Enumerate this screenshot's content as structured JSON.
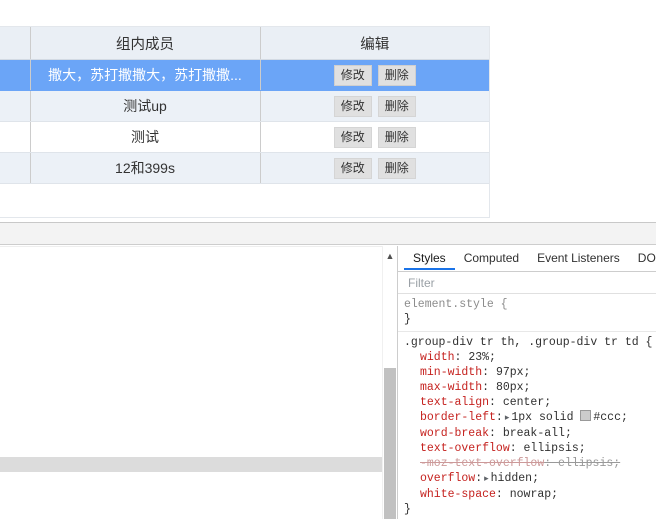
{
  "page": {
    "table": {
      "columns": [
        {
          "key": "index",
          "label": ""
        },
        {
          "key": "members",
          "label": "组内成员"
        },
        {
          "key": "edit",
          "label": "编辑"
        }
      ],
      "rows": [
        {
          "index": "",
          "members": "撒大，苏打撒撒大，苏打撒撒...",
          "edit_buttons": [
            "修改",
            "删除"
          ],
          "selected": true
        },
        {
          "index": "",
          "members": "测试up",
          "edit_buttons": [
            "修改",
            "删除"
          ],
          "selected": false
        },
        {
          "index": "",
          "members": "测试",
          "edit_buttons": [
            "修改",
            "删除"
          ],
          "selected": false
        },
        {
          "index": "",
          "members": "12和399s",
          "edit_buttons": [
            "修改",
            "删除"
          ],
          "selected": false
        }
      ]
    },
    "colors": {
      "header_bg": "#eaeff5",
      "row_alt_bg": "#ecf1f7",
      "row_bg": "#ffffff",
      "selected_bg": "#6ba5f7",
      "cell_border": "#ccc"
    }
  },
  "devtools": {
    "scrollbar": {
      "up_arrow_icon": "▲"
    },
    "styles_panel": {
      "tabs": [
        {
          "label": "Styles",
          "active": true
        },
        {
          "label": "Computed",
          "active": false
        },
        {
          "label": "Event Listeners",
          "active": false
        },
        {
          "label": "DOM",
          "active": false
        }
      ],
      "filter": {
        "value": "",
        "placeholder": "Filter"
      },
      "rules": [
        {
          "selector": "element.style {",
          "close": "}",
          "declarations": []
        },
        {
          "selector_parts": [
            ".group-div tr th, ",
            ".group-div tr td {"
          ],
          "selector": ".group-div tr th, .group-div tr td {",
          "close": "}",
          "declarations": [
            {
              "name": "width",
              "value": "23%;",
              "disclosure": false,
              "swatch": false,
              "disabled": false
            },
            {
              "name": "min-width",
              "value": "97px;",
              "disclosure": false,
              "swatch": false,
              "disabled": false
            },
            {
              "name": "max-width",
              "value": "80px;",
              "disclosure": false,
              "swatch": false,
              "disabled": false
            },
            {
              "name": "text-align",
              "value": "center;",
              "disclosure": false,
              "swatch": false,
              "disabled": false
            },
            {
              "name": "border-left",
              "value": "1px solid #ccc;",
              "disclosure": true,
              "swatch": true,
              "disabled": false
            },
            {
              "name": "word-break",
              "value": "break-all;",
              "disclosure": false,
              "swatch": false,
              "disabled": false
            },
            {
              "name": "text-overflow",
              "value": "ellipsis;",
              "disclosure": false,
              "swatch": false,
              "disabled": false
            },
            {
              "name": "-moz-text-overflow",
              "value": "ellipsis;",
              "disclosure": false,
              "swatch": false,
              "disabled": true
            },
            {
              "name": "overflow",
              "value": "hidden;",
              "disclosure": true,
              "swatch": false,
              "disabled": false
            },
            {
              "name": "white-space",
              "value": "nowrap;",
              "disclosure": false,
              "swatch": false,
              "disabled": false
            }
          ]
        }
      ]
    }
  }
}
